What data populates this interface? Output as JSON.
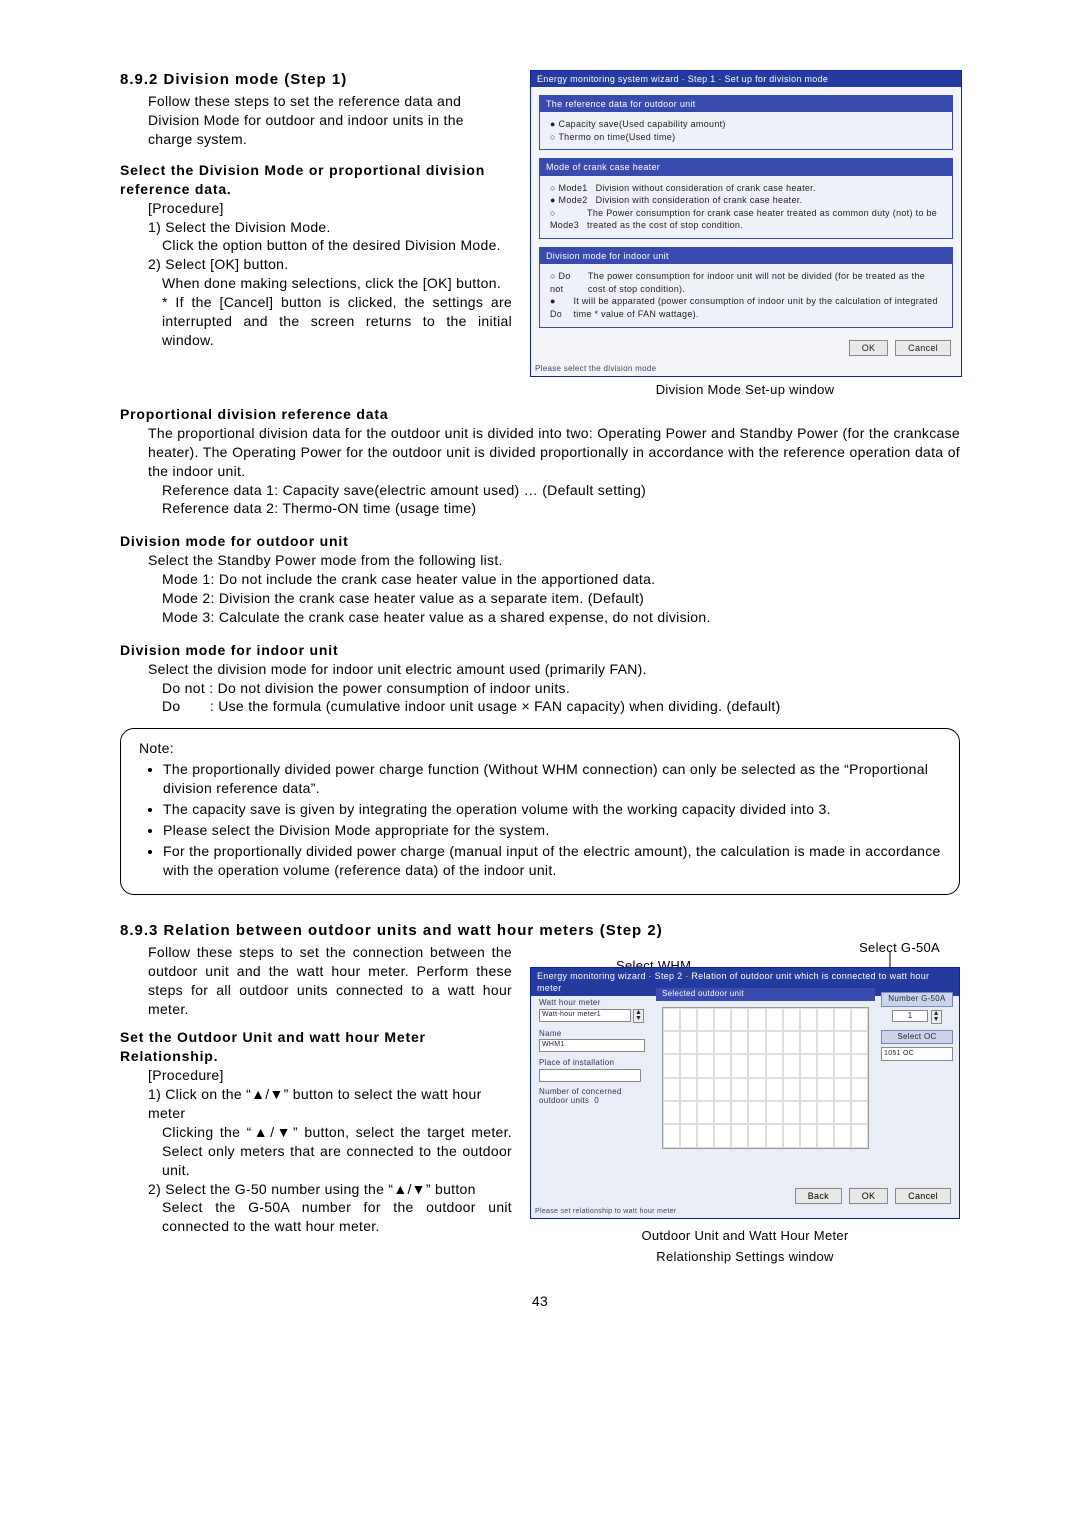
{
  "page_number": "43",
  "s892": {
    "heading": "8.9.2 Division mode (Step 1)",
    "intro1": "Follow these steps to set the reference data and Division Mode for outdoor and indoor units in the charge system.",
    "sel_hd": "Select the Division Mode or proportional division reference data.",
    "proc_label": "[Procedure]",
    "step1a": "1) Select the Division Mode.",
    "step1b": "Click the option button of the desired Division Mode.",
    "step2a": "2) Select [OK] button.",
    "step2b": "When done making selections, click the [OK] button.",
    "step2c": "*  If the [Cancel] button is clicked, the settings are interrupted and the screen returns to the initial window.",
    "fig1_caption": "Division Mode Set-up window",
    "prop_hd": "Proportional division reference data",
    "prop_p": "The proportional division data for the outdoor unit is divided into two: Operating Power and Standby Power (for the crankcase heater). The Operating Power for the outdoor unit is divided proportionally in accordance with the reference operation data of the indoor unit.",
    "prop_r1": "Reference data 1:  Capacity save(electric amount used) … (Default setting)",
    "prop_r2": "Reference data 2:  Thermo-ON time (usage time)",
    "out_hd": "Division mode for outdoor unit",
    "out_p": "Select the Standby Power mode from the following list.",
    "out_m1": "Mode 1: Do not include the crank case heater value in the apportioned data.",
    "out_m2": "Mode 2: Division the crank case heater value as a separate item. (Default)",
    "out_m3": "Mode 3: Calculate the crank case heater value as a shared expense, do not division.",
    "in_hd": "Division mode for indoor unit",
    "in_p": "Select the division mode for indoor unit electric amount used (primarily FAN).",
    "in_donot": "Do not : Do not division the power consumption of indoor units.",
    "in_do": "Do       : Use the formula (cumulative indoor unit usage × FAN capacity) when dividing. (default)"
  },
  "note": {
    "label": "Note:",
    "b1": "The proportionally divided power charge function (Without WHM connection) can only be selected as the “Proportional division reference data”.",
    "b2": "The capacity save is given by integrating the operation volume with the working capacity divided into 3.",
    "b3": "Please select the Division Mode appropriate for the system.",
    "b4": "For the proportionally divided power charge (manual input of the electric amount), the calculation is made in accordance with the operation volume (reference data) of the indoor unit."
  },
  "s893": {
    "heading": "8.9.3 Relation between outdoor units and watt hour meters (Step 2)",
    "intro": "Follow these steps to set the connection between the outdoor unit and the watt hour meter. Perform these steps for all outdoor units connected to a watt hour meter.",
    "set_hd": "Set the Outdoor Unit and watt hour Meter Relationship.",
    "proc_label": "[Procedure]",
    "s1a": "1)  Click on the “▲/▼” button to select the watt hour meter",
    "s1b": "Clicking the “▲/▼” button, select the target meter. Select only meters that are connected to the outdoor unit.",
    "s2a": "2)  Select the G-50 number using the “▲/▼” button",
    "s2b": "Select the G-50A number for the outdoor unit connected to the watt hour meter.",
    "callout_g50": "Select G-50A",
    "callout_whm": "Select WHM",
    "fig2_cap1": "Outdoor Unit and Watt Hour Meter",
    "fig2_cap2": "Relationship Settings window"
  },
  "win1": {
    "title": "Energy monitoring system wizard · Step 1 · Set up for division mode",
    "p1_hd": "The reference data for outdoor unit",
    "p1_o1": "Capacity save(Used capability amount)",
    "p1_o2": "Thermo on time(Used time)",
    "p2_hd": "Mode of crank case heater",
    "p2_m1l": "Mode1",
    "p2_m1t": "Division without consideration of crank case heater.",
    "p2_m2l": "Mode2",
    "p2_m2t": "Division with consideration of crank case heater.",
    "p2_m3l": "Mode3",
    "p2_m3t": "The Power consumption for crank case heater treated as common duty (not) to be treated as the cost of stop condition.",
    "p3_hd": "Division mode for indoor unit",
    "p3_o1l": "Do not",
    "p3_o1t": "The power consumption for indoor unit will not be divided (for be treated as the cost of stop condition).",
    "p3_o2l": "Do",
    "p3_o2t": "It will be apparated (power consumption of indoor unit by the calculation of integrated time * value of FAN wattage).",
    "ok": "OK",
    "cancel": "Cancel",
    "foot": "Please select the division mode"
  },
  "win2": {
    "title": "Energy monitoring wizard · Step 2 · Relation of outdoor unit which is connected to watt hour meter",
    "whm_label": "Watt hour meter",
    "whm_val": "Watt-hour meter1",
    "name_label": "Name",
    "name_val": "WHM1",
    "place_label": "Place of installation",
    "conn_label": "Number of concerned outdoor units",
    "conn_val": "0",
    "right_num_lbl": "Number G-50A",
    "right_sel_lbl": "Select OC",
    "right_g50": "1",
    "right_oc": "1051 OC",
    "back": "Back",
    "ok": "OK",
    "cancel": "Cancel",
    "foot": "Please set relationship to watt hour meter"
  }
}
